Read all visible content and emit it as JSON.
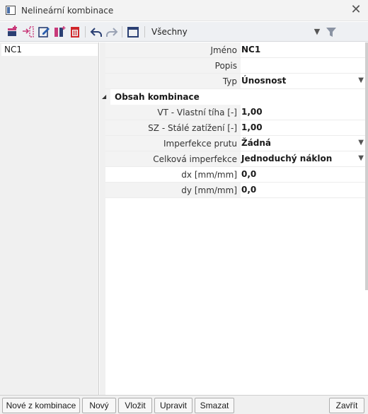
{
  "window": {
    "title": "Nelineární kombinace"
  },
  "toolbar": {
    "filter_value": "Všechny",
    "colors": {
      "edit_blue": "#2a5fb0",
      "delete_red": "#d0262a",
      "add_pink": "#c83a7a"
    }
  },
  "list": {
    "items": [
      "NC1"
    ]
  },
  "properties": {
    "name": {
      "label": "Jméno",
      "value": "NC1"
    },
    "description": {
      "label": "Popis",
      "value": ""
    },
    "type": {
      "label": "Typ",
      "value": "Únosnost"
    },
    "section": {
      "title": "Obsah kombinace"
    },
    "vt": {
      "label": "VT - Vlastní tíha [-]",
      "value": "1,00"
    },
    "sz": {
      "label": "SZ - Stálé zatížení [-]",
      "value": "1,00"
    },
    "member_imperfection": {
      "label": "Imperfekce prutu",
      "value": "Žádná"
    },
    "global_imperfection": {
      "label": "Celková imperfekce",
      "value": "Jednoduchý náklon"
    },
    "dx": {
      "label": "dx [mm/mm]",
      "value": "0,0"
    },
    "dy": {
      "label": "dy [mm/mm]",
      "value": "0,0"
    }
  },
  "footer": {
    "new_from_combination": "Nové z kombinace",
    "new": "Nový",
    "insert": "Vložit",
    "edit": "Upravit",
    "delete": "Smazat",
    "close": "Zavřít"
  }
}
